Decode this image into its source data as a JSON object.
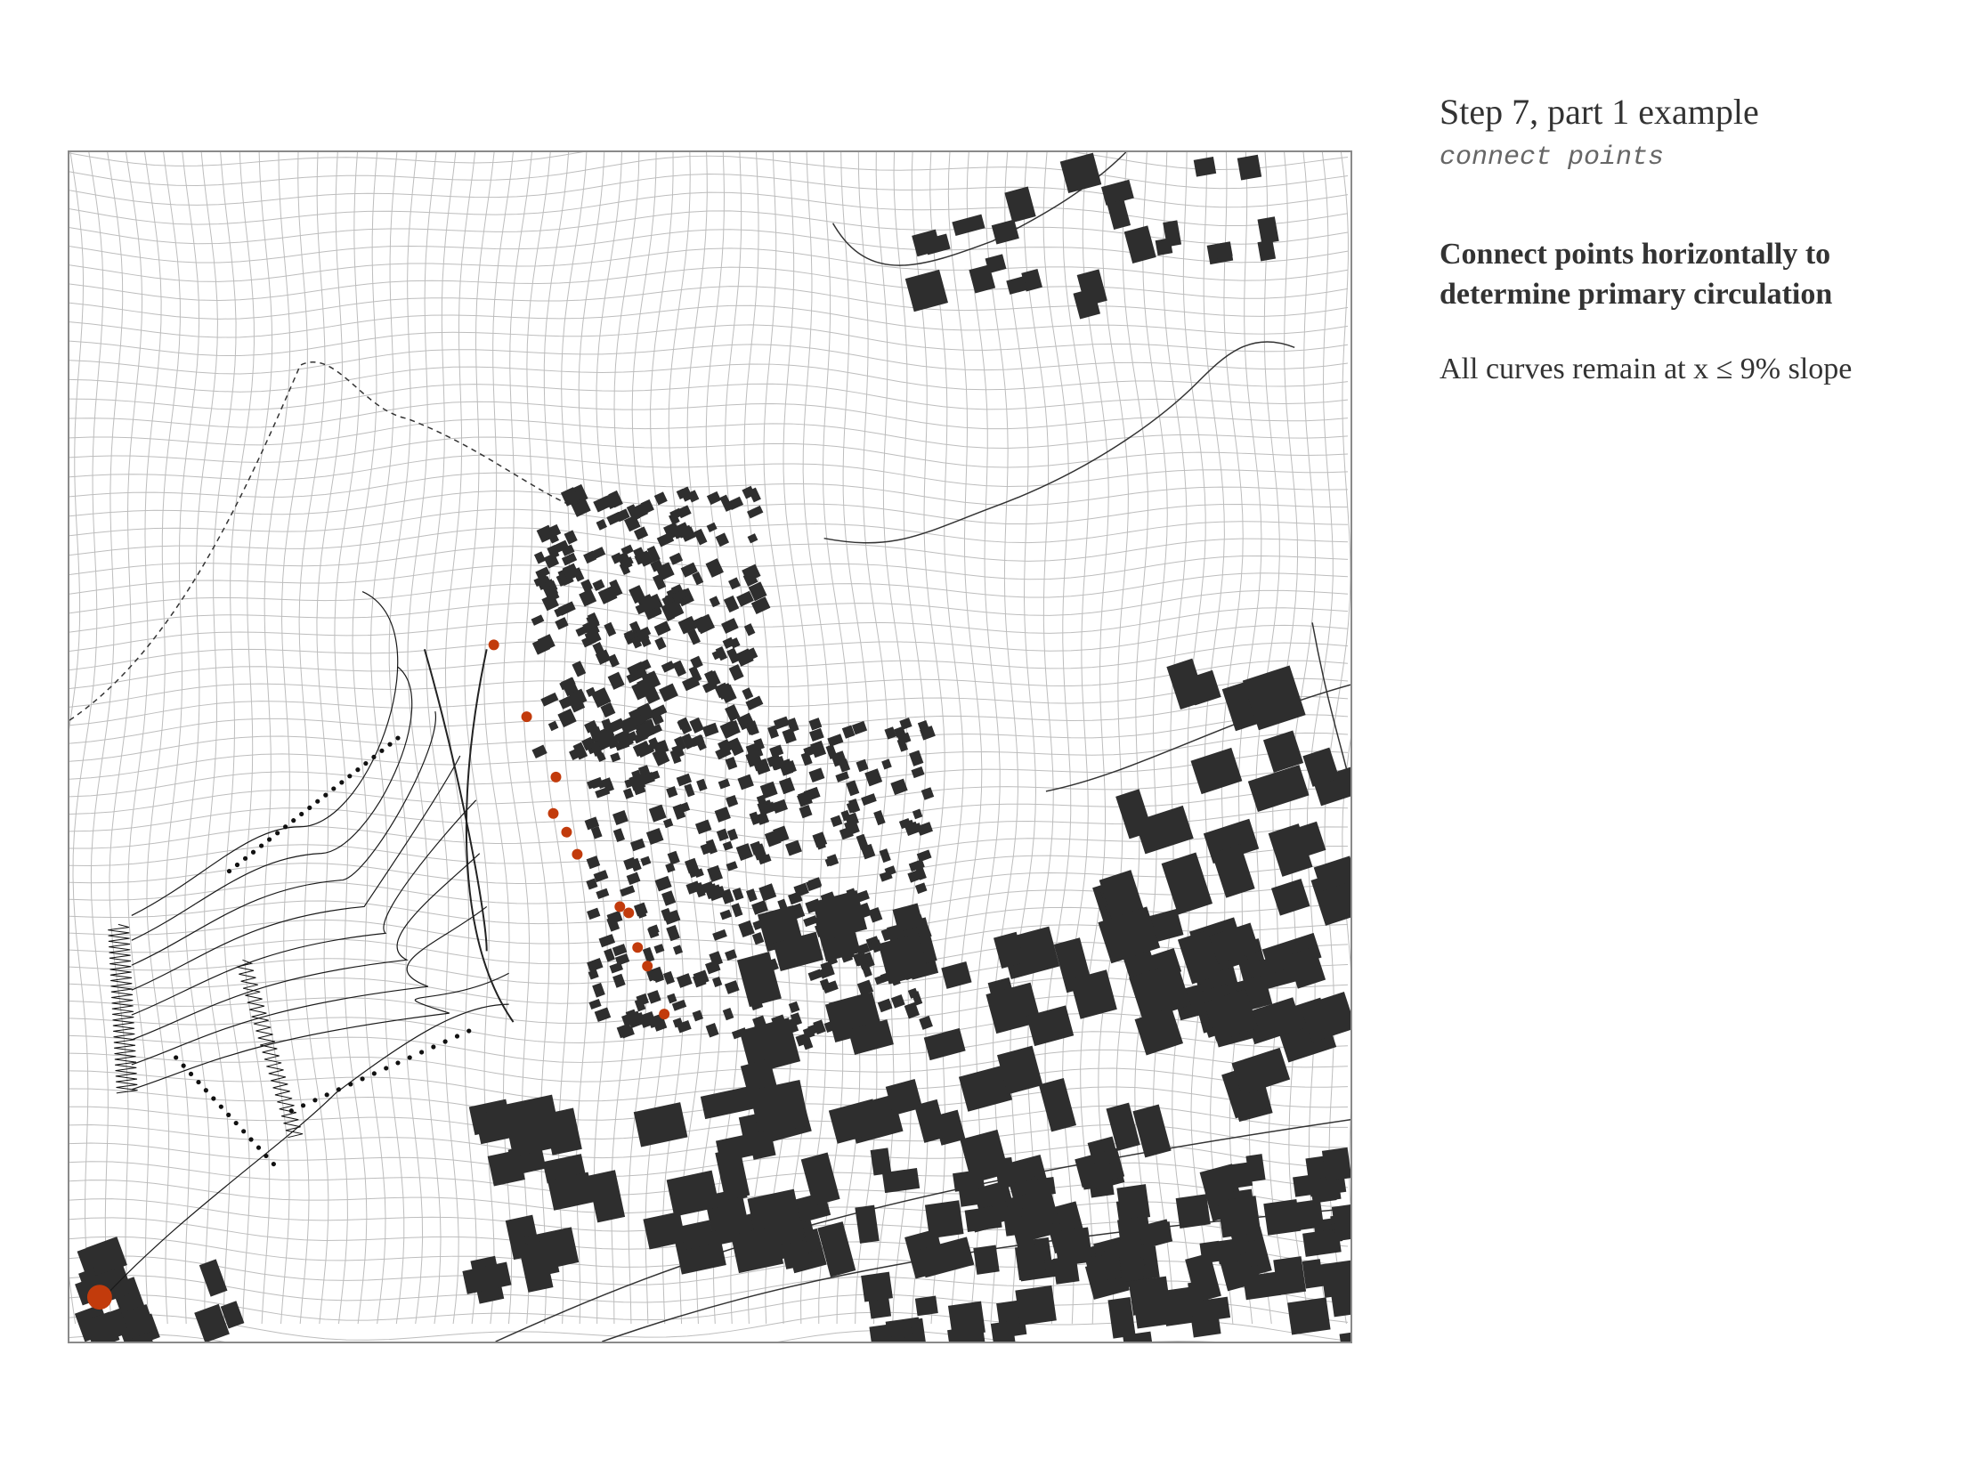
{
  "panel": {
    "title": "Step 7, part 1 example",
    "subtitle": "connect points",
    "heading": "Connect points horizontally to determine primary circulation",
    "note": "All curves remain at x ≤ 9% slope"
  },
  "colors": {
    "grid": "#bdbdbd",
    "building": "#2e2e2e",
    "curve": "#1a1a1a",
    "point": "#c23b0c",
    "frame": "#8a8a8a",
    "text": "#333333"
  }
}
